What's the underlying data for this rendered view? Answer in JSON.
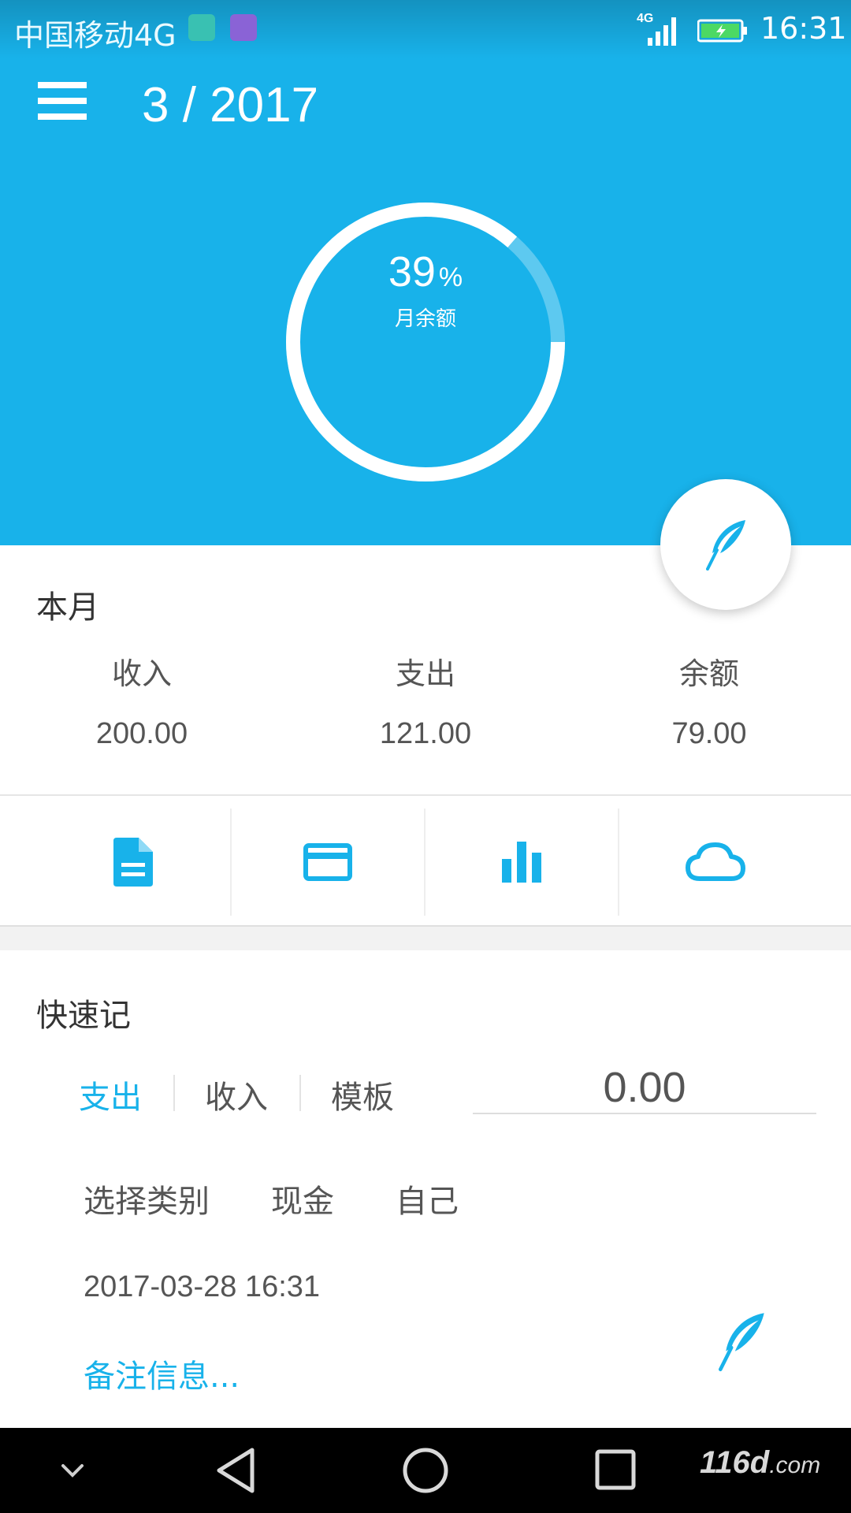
{
  "status_bar": {
    "carrier": "中国移动4G",
    "network": "4G",
    "time": "16:31"
  },
  "header": {
    "month": "3 / 2017",
    "ring_percent": "39",
    "ring_percent_sign": "%",
    "ring_label": "月余额",
    "ring_fraction": 0.39
  },
  "summary": {
    "title": "本月",
    "stats": [
      {
        "label": "收入",
        "value": "200.00"
      },
      {
        "label": "支出",
        "value": "121.00"
      },
      {
        "label": "余额",
        "value": "79.00"
      }
    ]
  },
  "tools": [
    {
      "icon": "document-icon"
    },
    {
      "icon": "card-icon"
    },
    {
      "icon": "bar-chart-icon"
    },
    {
      "icon": "cloud-icon"
    }
  ],
  "quick": {
    "title": "快速记",
    "tabs": [
      "支出",
      "收入",
      "模板"
    ],
    "active_tab": "支出",
    "amount": "0.00",
    "options": [
      "选择类别",
      "现金",
      "自己"
    ],
    "datetime": "2017-03-28 16:31",
    "note_placeholder": "备注信息..."
  },
  "navbar": {
    "watermark_main": "116d",
    "watermark_suffix": ".com"
  },
  "colors": {
    "accent": "#18b2ea",
    "text": "#555555",
    "navbar": "#000000"
  }
}
